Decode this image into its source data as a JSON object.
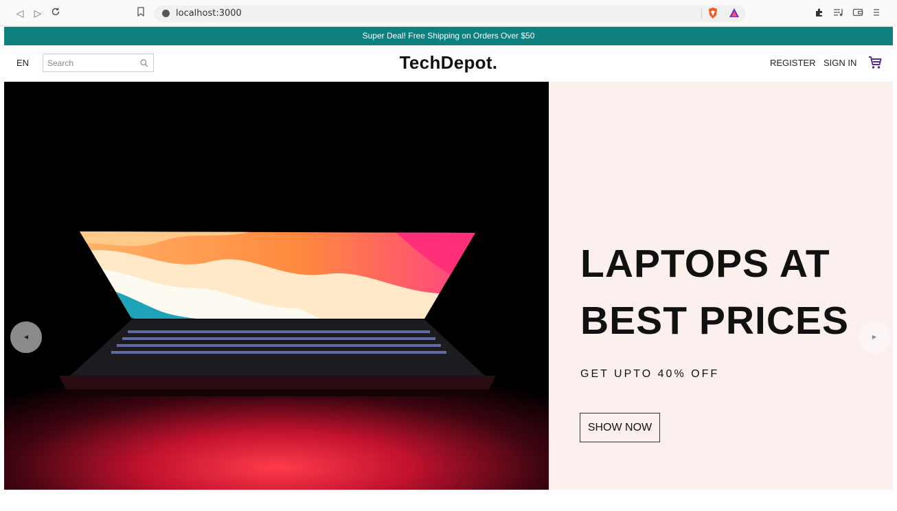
{
  "browser": {
    "url": "localhost:3000"
  },
  "announcement": {
    "text": "Super Deal! Free Shipping on Orders Over $50"
  },
  "header": {
    "language": "EN",
    "search_placeholder": "Search",
    "logo": "TechDepot.",
    "register_label": "REGISTER",
    "signin_label": "SIGN IN"
  },
  "hero": {
    "title_line1": "LAPTOPS AT",
    "title_line2": "BEST PRICES",
    "subtitle": "GET UPTO 40% OFF",
    "button_label": "SHOW NOW",
    "background_color": "#fcf0ef"
  },
  "colors": {
    "announcement_bg": "#0f8080",
    "cart_icon": "#5b2d90"
  },
  "icons": {
    "back": "back-icon",
    "forward": "forward-icon",
    "reload": "reload-icon",
    "bookmark": "bookmark-icon",
    "site_info": "info-icon",
    "brave_shields": "brave-shield-icon",
    "brave_rewards": "brave-rewards-icon",
    "extensions": "puzzle-icon",
    "playlist": "playlist-icon",
    "wallet": "wallet-icon",
    "menu": "hamburger-icon",
    "search": "search-icon",
    "cart": "cart-icon",
    "slider_left": "chevron-left-icon",
    "slider_right": "chevron-right-icon"
  }
}
